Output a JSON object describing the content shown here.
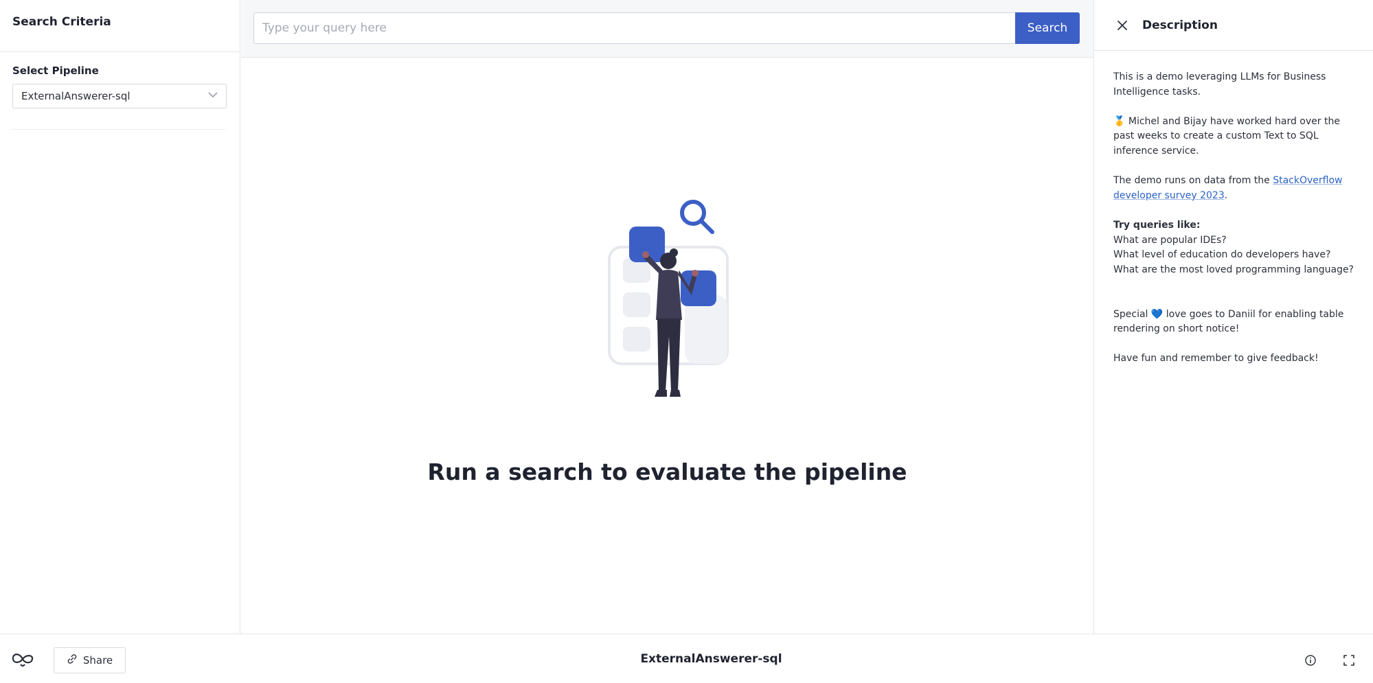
{
  "left_panel": {
    "title": "Search Criteria",
    "pipeline_label": "Select Pipeline",
    "pipeline_value": "ExternalAnswerer-sql"
  },
  "search": {
    "placeholder": "Type your query here",
    "value": "",
    "button_label": "Search"
  },
  "main": {
    "empty_state_text": "Run a search to evaluate the pipeline",
    "illustration_icon": "person-searching-illustration"
  },
  "description_panel": {
    "title": "Description",
    "intro": "This is a demo leveraging LLMs for Business Intelligence tasks.",
    "credits_emoji": "🥇",
    "credits_text": " Michel and Bijay have worked hard over the past weeks to create a custom Text to SQL inference service.",
    "data_source_prefix": "The demo runs on data from the ",
    "data_source_link": "StackOverflow developer survey 2023",
    "data_source_suffix": ".",
    "queries_heading": "Try queries like:",
    "queries": [
      "What are popular IDEs?",
      "What level of education do developers have?",
      "What are the most loved programming language?"
    ],
    "thanks_prefix": "Special ",
    "thanks_emoji": "💙",
    "thanks_suffix": " love goes to Daniil for enabling table rendering on short notice!",
    "closing": "Have fun and remember to give feedback!"
  },
  "footer": {
    "share_label": "Share",
    "pipeline_name": "ExternalAnswerer-sql"
  },
  "colors": {
    "accent": "#3c5fc6",
    "link": "#2a63c6",
    "text": "#1f2330",
    "border": "#e3e5ea"
  }
}
